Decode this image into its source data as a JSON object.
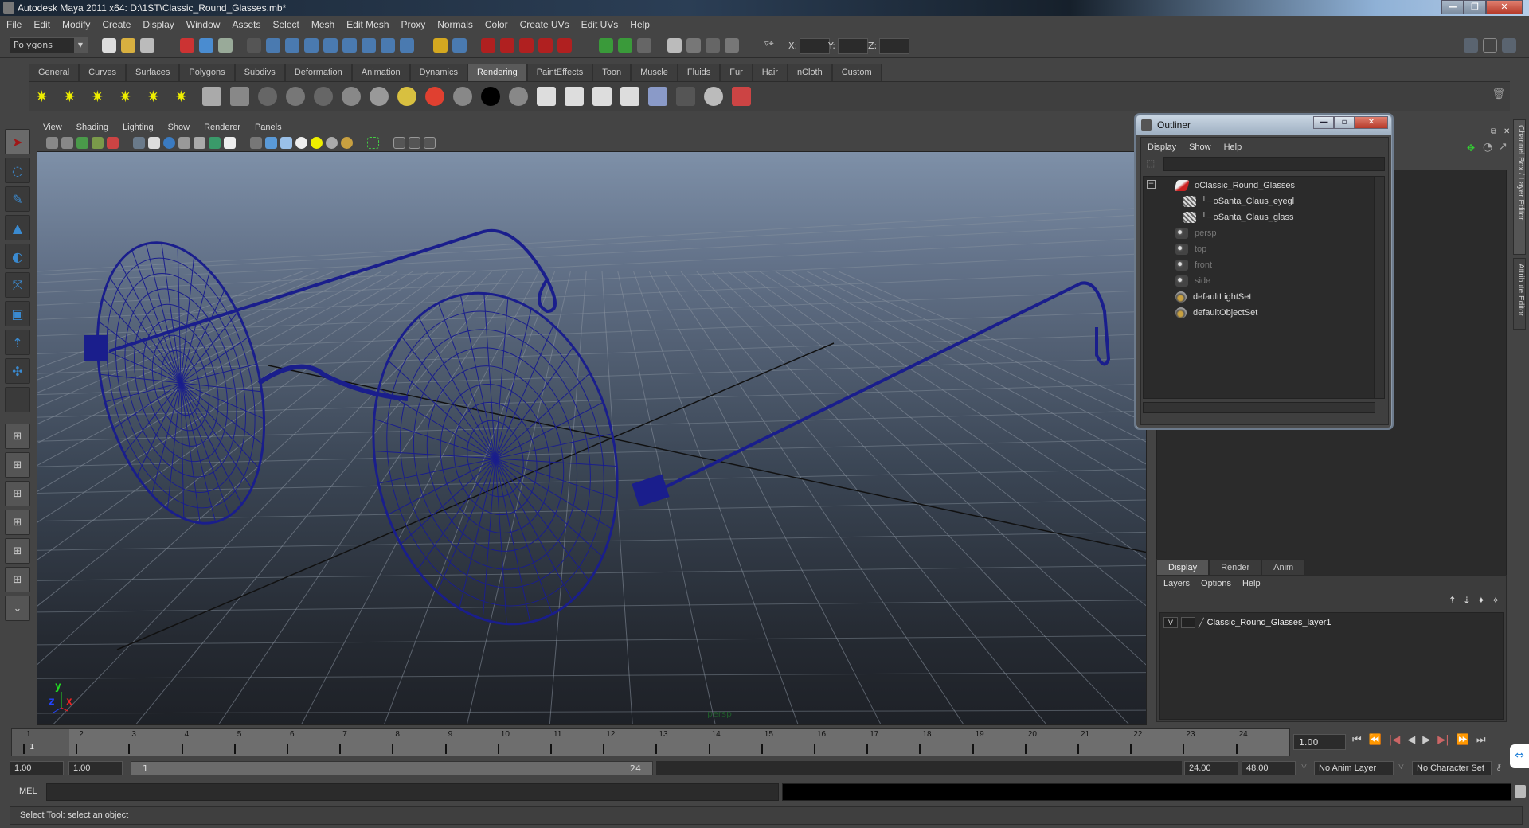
{
  "window": {
    "title": "Autodesk Maya 2011 x64: D:\\1ST\\Classic_Round_Glasses.mb*",
    "controls": [
      "minimize",
      "restore",
      "close"
    ]
  },
  "menubar": [
    "File",
    "Edit",
    "Modify",
    "Create",
    "Display",
    "Window",
    "Assets",
    "Select",
    "Mesh",
    "Edit Mesh",
    "Proxy",
    "Normals",
    "Color",
    "Create UVs",
    "Edit UVs",
    "Help"
  ],
  "statusline": {
    "menu_set": "Polygons",
    "coord_labels": [
      "X:",
      "Y:",
      "Z:"
    ]
  },
  "shelf": {
    "tabs": [
      "General",
      "Curves",
      "Surfaces",
      "Polygons",
      "Subdivs",
      "Deformation",
      "Animation",
      "Dynamics",
      "Rendering",
      "PaintEffects",
      "Toon",
      "Muscle",
      "Fluids",
      "Fur",
      "Hair",
      "nCloth",
      "Custom"
    ],
    "active_tab": "Rendering",
    "icons": [
      "ambient-light",
      "directional-light",
      "point-light",
      "spot-light",
      "area-light",
      "volume-light",
      "camera",
      "hypershade",
      "anisotropic",
      "blinn",
      "lambert",
      "phong",
      "phong-e",
      "ramp",
      "surface-shader",
      "use-background",
      "layered-black",
      "layered-grey",
      "render-view",
      "ipr-render",
      "batch-render",
      "render-settings",
      "render-layer",
      "remove-material",
      "material-attrs",
      "paint-brush"
    ]
  },
  "toolbox": [
    "select-tool",
    "lasso-tool",
    "paint-select-tool",
    "move-tool",
    "rotate-tool",
    "scale-tool",
    "universal-manipulator",
    "soft-mod-tool",
    "show-manipulator",
    "last-tool",
    "single-perspective-layout",
    "four-view-layout",
    "outliner-persp-layout",
    "persp-graph-layout",
    "hypershade-persp-layout",
    "persp-outliner-graph-layout",
    "more-layouts"
  ],
  "panel": {
    "menus": [
      "View",
      "Shading",
      "Lighting",
      "Show",
      "Renderer",
      "Panels"
    ],
    "camera": "persp",
    "axis": {
      "x": "x",
      "y": "y",
      "z": "z"
    }
  },
  "outliner": {
    "title": "Outliner",
    "menus": [
      "Display",
      "Show",
      "Help"
    ],
    "items": [
      {
        "name": "Classic_Round_Glasses",
        "type": "transform",
        "indent": 0,
        "dim": false
      },
      {
        "name": "Santa_Claus_eyegl",
        "type": "mesh",
        "indent": 1,
        "dim": false
      },
      {
        "name": "Santa_Claus_glass",
        "type": "mesh",
        "indent": 1,
        "dim": false
      },
      {
        "name": "persp",
        "type": "camera",
        "indent": 0,
        "dim": true
      },
      {
        "name": "top",
        "type": "camera",
        "indent": 0,
        "dim": true
      },
      {
        "name": "front",
        "type": "camera",
        "indent": 0,
        "dim": true
      },
      {
        "name": "side",
        "type": "camera",
        "indent": 0,
        "dim": true
      },
      {
        "name": "defaultLightSet",
        "type": "set",
        "indent": 0,
        "dim": false
      },
      {
        "name": "defaultObjectSet",
        "type": "set",
        "indent": 0,
        "dim": false
      }
    ]
  },
  "layer_editor": {
    "tabs": [
      "Display",
      "Render",
      "Anim"
    ],
    "active_tab": "Display",
    "menus": [
      "Layers",
      "Options",
      "Help"
    ],
    "layers": [
      {
        "visible": "V",
        "name": "Classic_Round_Glasses_layer1"
      }
    ]
  },
  "side_tabs": [
    "Channel Box / Layer Editor",
    "Attribute Editor"
  ],
  "time_slider": {
    "frames": [
      1,
      2,
      3,
      4,
      5,
      6,
      7,
      8,
      9,
      10,
      11,
      12,
      13,
      14,
      15,
      16,
      17,
      18,
      19,
      20,
      21,
      22,
      23,
      24
    ],
    "current_frame": "1",
    "current_time": "1.00"
  },
  "range": {
    "start_time": "1.00",
    "playback_start": "1.00",
    "range_start": "1",
    "range_end": "24",
    "playback_end": "24.00",
    "end_time": "48.00",
    "anim_layer": "No Anim Layer",
    "character_set": "No Character Set"
  },
  "command_line": {
    "label": "MEL",
    "value": ""
  },
  "help_line": "Select Tool: select an object",
  "colors": {
    "wireframe": "#1a1e8c",
    "ui_bg": "#444444",
    "field_bg": "#2b2b2b",
    "timeline": "#6e6e6e"
  }
}
